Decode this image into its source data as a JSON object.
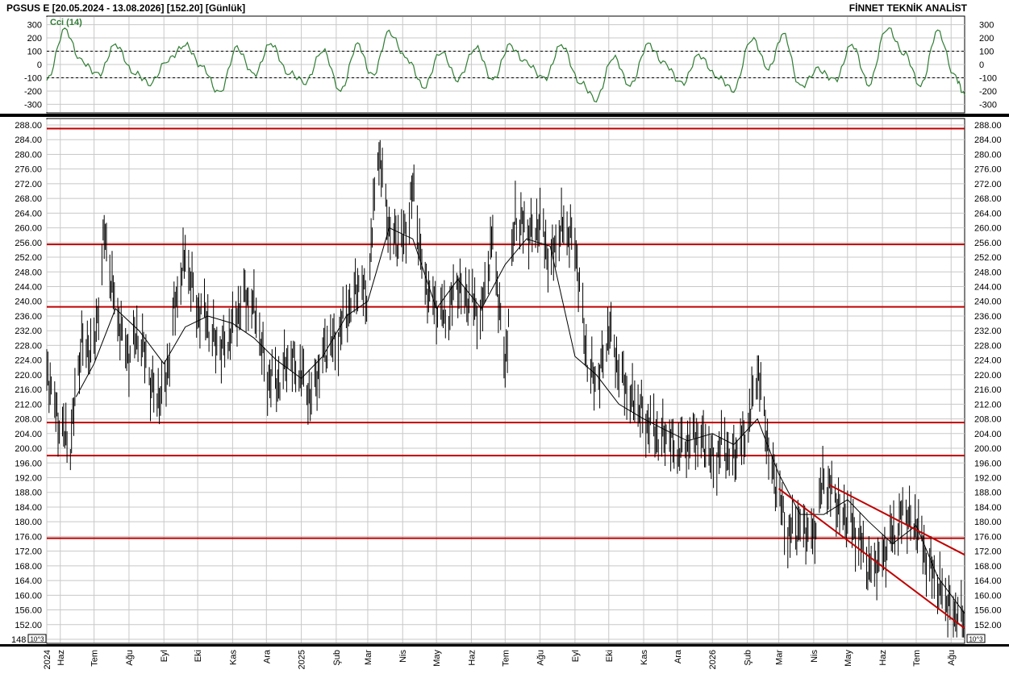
{
  "header": {
    "left": "PGSUS E  [20.05.2024 - 13.08.2026]  [152.20]  [Günlük]",
    "right": "FİNNET TEKNİK ANALİST"
  },
  "colors": {
    "background": "#ffffff",
    "grid": "#c8c8c8",
    "price": "#000000",
    "cci": "#2e7d32",
    "horizontal_levels": "#c00000",
    "channel": "#c00000"
  },
  "chart_data": [
    {
      "type": "line",
      "title": "Cci (14)",
      "ylim": [
        -340,
        340
      ],
      "yticks": [
        300,
        200,
        100,
        0,
        -100,
        -200,
        -300
      ],
      "ytick_labels": [
        "300",
        "200",
        "100",
        "0",
        "-100",
        "-200",
        "-300"
      ],
      "reference_lines": [
        100,
        -100
      ],
      "x": [
        "2024-05-20",
        "2024-06-05",
        "2024-06-20",
        "2024-07-05",
        "2024-07-20",
        "2024-08-05",
        "2024-08-20",
        "2024-09-05",
        "2024-09-20",
        "2024-10-05",
        "2024-10-20",
        "2024-11-05",
        "2024-11-20",
        "2024-12-05",
        "2024-12-20",
        "2025-01-05",
        "2025-01-20",
        "2025-02-05",
        "2025-02-20",
        "2025-03-05",
        "2025-03-20",
        "2025-04-05",
        "2025-04-20",
        "2025-05-05",
        "2025-05-20",
        "2025-06-05",
        "2025-06-20",
        "2025-07-05",
        "2025-07-20",
        "2025-08-05",
        "2025-08-20",
        "2025-09-05",
        "2025-09-20",
        "2025-10-05",
        "2025-10-20",
        "2025-11-05",
        "2025-11-20",
        "2025-12-05",
        "2025-12-20",
        "2026-01-05",
        "2026-01-20",
        "2026-02-05",
        "2026-02-20",
        "2026-03-05",
        "2026-03-20",
        "2026-04-05",
        "2026-04-20",
        "2026-05-05",
        "2026-05-20",
        "2026-06-05",
        "2026-06-20",
        "2026-07-05",
        "2026-07-20",
        "2026-08-05",
        "2026-08-13"
      ],
      "y": [
        -120,
        260,
        20,
        -80,
        150,
        -60,
        -140,
        40,
        150,
        -20,
        -220,
        120,
        -80,
        160,
        -60,
        -130,
        110,
        -200,
        150,
        -90,
        240,
        40,
        -170,
        100,
        -110,
        130,
        -120,
        140,
        10,
        -110,
        150,
        -130,
        -260,
        60,
        -160,
        150,
        0,
        -150,
        70,
        -90,
        -190,
        200,
        -30,
        230,
        -170,
        -40,
        -120,
        150,
        -150,
        280,
        90,
        -160,
        250,
        -100,
        -230
      ],
      "y_note": "approximate"
    },
    {
      "type": "line",
      "ylim": [
        147,
        289
      ],
      "yticks": [
        288,
        284,
        280,
        276,
        272,
        268,
        264,
        260,
        256,
        252,
        248,
        244,
        240,
        236,
        232,
        228,
        224,
        220,
        216,
        212,
        208,
        204,
        200,
        196,
        192,
        188,
        184,
        180,
        176,
        172,
        168,
        164,
        160,
        156,
        152,
        148
      ],
      "ytick_labels": [
        "288.00",
        "284.00",
        "280.00",
        "276.00",
        "272.00",
        "268.00",
        "264.00",
        "260.00",
        "256.00",
        "252.00",
        "248.00",
        "244.00",
        "240.00",
        "236.00",
        "232.00",
        "228.00",
        "224.00",
        "220.00",
        "216.00",
        "212.00",
        "208.00",
        "204.00",
        "200.00",
        "196.00",
        "192.00",
        "188.00",
        "184.00",
        "180.00",
        "176.00",
        "172.00",
        "168.00",
        "164.00",
        "160.00",
        "156.00",
        "152.00",
        "148"
      ],
      "scale_badge": "10^3",
      "x_axis_labels": [
        "2024",
        "Haz",
        "Tem",
        "Ağu",
        "Eyl",
        "Eki",
        "Kas",
        "Ara",
        "2025",
        "Şub",
        "Mar",
        "Nis",
        "May",
        "Haz",
        "Tem",
        "Ağu",
        "Eyl",
        "Eki",
        "Kas",
        "Ara",
        "2026",
        "Şub",
        "Mar",
        "Nis",
        "May",
        "Haz",
        "Tem",
        "Ağu"
      ],
      "x_axis_dates": [
        "2024-05-20",
        "2024-06-01",
        "2024-07-01",
        "2024-08-01",
        "2024-09-01",
        "2024-10-01",
        "2024-11-01",
        "2024-12-01",
        "2025-01-01",
        "2025-02-01",
        "2025-03-01",
        "2025-04-01",
        "2025-05-01",
        "2025-06-01",
        "2025-07-01",
        "2025-08-01",
        "2025-09-01",
        "2025-10-01",
        "2025-11-01",
        "2025-12-01",
        "2026-01-01",
        "2026-02-01",
        "2026-03-01",
        "2026-04-01",
        "2026-05-01",
        "2026-06-01",
        "2026-07-01",
        "2026-08-01"
      ],
      "x_range": [
        "2024-05-20",
        "2026-08-13"
      ],
      "horizontal_levels": [
        287,
        255.5,
        238.5,
        207,
        198,
        175.5
      ],
      "series": [
        {
          "kind": "price",
          "x": [
            "2024-05-20",
            "2024-06-01",
            "2024-06-10",
            "2024-06-20",
            "2024-07-01",
            "2024-07-10",
            "2024-07-20",
            "2024-08-01",
            "2024-08-10",
            "2024-08-20",
            "2024-09-01",
            "2024-09-10",
            "2024-09-20",
            "2024-10-01",
            "2024-10-10",
            "2024-10-20",
            "2024-11-01",
            "2024-11-10",
            "2024-11-20",
            "2024-12-01",
            "2024-12-10",
            "2024-12-20",
            "2025-01-01",
            "2025-01-10",
            "2025-01-20",
            "2025-02-01",
            "2025-02-10",
            "2025-02-20",
            "2025-03-01",
            "2025-03-10",
            "2025-03-20",
            "2025-04-01",
            "2025-04-10",
            "2025-04-20",
            "2025-05-01",
            "2025-05-10",
            "2025-05-20",
            "2025-06-01",
            "2025-06-10",
            "2025-06-20",
            "2025-07-01",
            "2025-07-10",
            "2025-07-20",
            "2025-08-01",
            "2025-08-10",
            "2025-08-20",
            "2025-09-01",
            "2025-09-10",
            "2025-09-20",
            "2025-10-01",
            "2025-10-10",
            "2025-10-20",
            "2025-11-01",
            "2025-11-10",
            "2025-11-20",
            "2025-12-01",
            "2025-12-10",
            "2025-12-20",
            "2026-01-01",
            "2026-01-10",
            "2026-01-20",
            "2026-02-01",
            "2026-02-10",
            "2026-02-20",
            "2026-03-01",
            "2026-03-10",
            "2026-03-20",
            "2026-04-01",
            "2026-04-10",
            "2026-04-20",
            "2026-05-01",
            "2026-05-10",
            "2026-05-20",
            "2026-06-01",
            "2026-06-10",
            "2026-06-20",
            "2026-07-01",
            "2026-07-10",
            "2026-07-20",
            "2026-08-01",
            "2026-08-13"
          ],
          "y": [
            222,
            205,
            201,
            230,
            226,
            258,
            238,
            225,
            232,
            217,
            214,
            237,
            252,
            238,
            235,
            225,
            233,
            242,
            238,
            220,
            218,
            224,
            220,
            214,
            226,
            229,
            237,
            245,
            240,
            282,
            260,
            255,
            270,
            246,
            238,
            235,
            245,
            240,
            236,
            258,
            222,
            264,
            258,
            262,
            250,
            260,
            257,
            228,
            215,
            233,
            222,
            213,
            209,
            205,
            203,
            199,
            202,
            204,
            196,
            201,
            198,
            204,
            222,
            200,
            186,
            176,
            180,
            176,
            192,
            186,
            181,
            176,
            167,
            171,
            176,
            182,
            180,
            170,
            162,
            157,
            152
          ]
        },
        {
          "kind": "moving_average",
          "x": [
            "2024-06-15",
            "2024-07-01",
            "2024-07-20",
            "2024-08-10",
            "2024-09-01",
            "2024-09-20",
            "2024-10-10",
            "2024-11-01",
            "2024-11-20",
            "2024-12-10",
            "2025-01-01",
            "2025-01-20",
            "2025-02-10",
            "2025-03-01",
            "2025-03-20",
            "2025-04-10",
            "2025-05-01",
            "2025-05-20",
            "2025-06-10",
            "2025-07-01",
            "2025-07-20",
            "2025-08-10",
            "2025-09-01",
            "2025-09-20",
            "2025-10-10",
            "2025-11-01",
            "2025-11-20",
            "2025-12-10",
            "2026-01-01",
            "2026-01-20",
            "2026-02-10",
            "2026-03-01",
            "2026-03-20",
            "2026-04-10",
            "2026-05-01",
            "2026-05-20",
            "2026-06-10",
            "2026-07-01",
            "2026-07-20",
            "2026-08-13"
          ],
          "y": [
            214,
            223,
            238,
            232,
            223,
            233,
            236,
            234,
            230,
            224,
            219,
            225,
            236,
            240,
            260,
            257,
            238,
            246,
            238,
            250,
            257,
            255,
            225,
            220,
            212,
            208,
            205,
            202,
            204,
            201,
            208,
            193,
            182,
            182,
            186,
            180,
            174,
            179,
            165,
            155
          ]
        }
      ],
      "channel_lines": [
        {
          "from": [
            "2026-03-01",
            189
          ],
          "to": [
            "2026-08-13",
            151
          ]
        },
        {
          "from": [
            "2026-04-15",
            190
          ],
          "to": [
            "2026-08-13",
            171
          ]
        }
      ]
    }
  ]
}
